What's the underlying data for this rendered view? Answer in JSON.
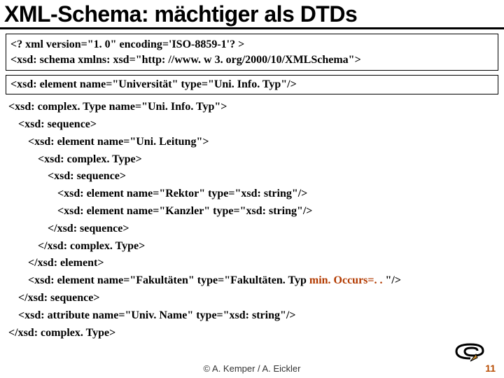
{
  "title": "XML-Schema: mächtiger als DTDs",
  "block1": {
    "line1": "<? xml version=\"1. 0\" encoding='ISO-8859-1'? >",
    "line2": "<xsd: schema xmlns: xsd=\"http: //www. w 3. org/2000/10/XMLSchema\">"
  },
  "block2": {
    "line1": "<xsd: element name=\"Universität\" type=\"Uni. Info. Typ\"/>"
  },
  "body": {
    "l1": "<xsd: complex. Type name=\"Uni. Info. Typ\">",
    "l2": "<xsd: sequence>",
    "l3": "<xsd: element name=\"Uni. Leitung\">",
    "l4": "<xsd: complex. Type>",
    "l5": "<xsd: sequence>",
    "l6": "<xsd: element name=\"Rektor\" type=\"xsd: string\"/>",
    "l7": "<xsd: element name=\"Kanzler\" type=\"xsd: string\"/>",
    "l8": "</xsd: sequence>",
    "l9": "</xsd: complex. Type>",
    "l10": "</xsd: element>",
    "l11a": "<xsd: element name=\"Fakultäten\" type=\"Fakultäten. Typ ",
    "l11b": "min. Occurs=. . ",
    "l11c": "\"/>",
    "l12": "</xsd: sequence>",
    "l13": "<xsd: attribute name=\"Univ. Name\" type=\"xsd: string\"/>",
    "l14": "</xsd: complex. Type>"
  },
  "footer": "© A. Kemper / A. Eickler",
  "pagenum": "11"
}
